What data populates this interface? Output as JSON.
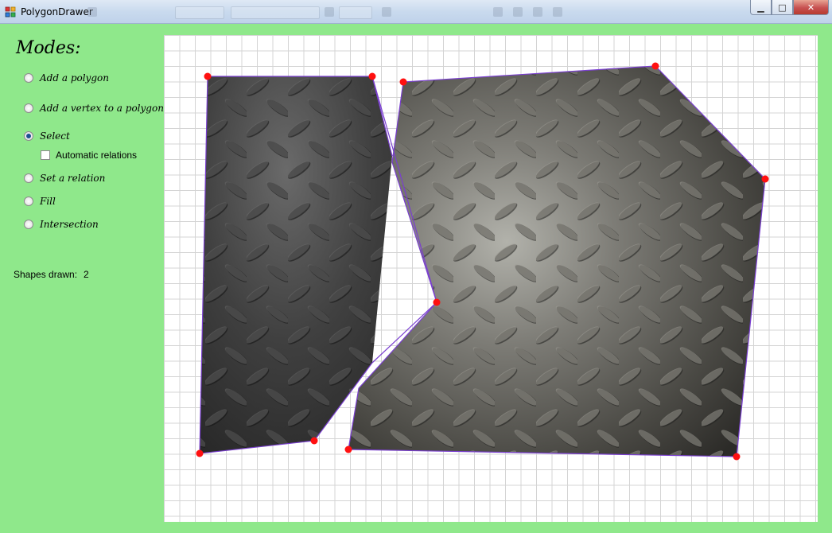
{
  "window": {
    "title": "PolygonDrawer",
    "minimize_glyph": "▁",
    "maximize_glyph": "□",
    "close_glyph": "✕"
  },
  "sidebar": {
    "modes_title": "Modes:",
    "modes": [
      {
        "label": "Add a polygon",
        "checked": false
      },
      {
        "label": "Add a vertex to a polygon",
        "checked": false
      },
      {
        "label": "Select",
        "checked": true
      },
      {
        "label": "Set a relation",
        "checked": false
      },
      {
        "label": "Fill",
        "checked": false
      },
      {
        "label": "Intersection",
        "checked": false
      }
    ],
    "automatic_relations": {
      "label": "Automatic relations",
      "checked": false
    },
    "shapes_drawn_label": "Shapes drawn:",
    "shapes_drawn_value": "2"
  },
  "colors": {
    "panel_bg": "#8fe88b",
    "edge": "#7a3fd0",
    "vertex": "#ff1010",
    "grid": "#d4d4d4"
  },
  "icons": [
    "app-icon",
    "minimize-icon",
    "maximize-icon",
    "close-icon"
  ]
}
